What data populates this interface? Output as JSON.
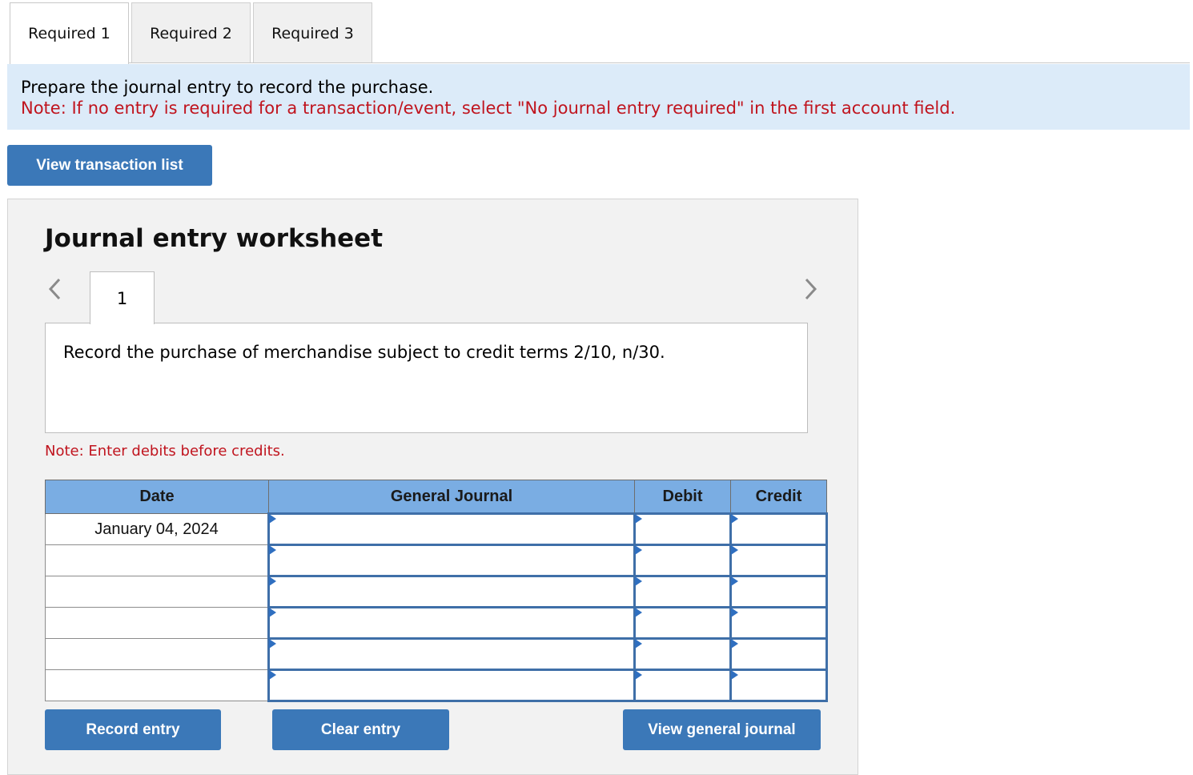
{
  "tabs": [
    {
      "label": "Required 1",
      "active": true
    },
    {
      "label": "Required 2",
      "active": false
    },
    {
      "label": "Required 3",
      "active": false
    }
  ],
  "instructions": {
    "main": "Prepare the journal entry to record the purchase.",
    "note": "Note: If no entry is required for a transaction/event, select \"No journal entry required\" in the first account field."
  },
  "buttons": {
    "view_transaction_list": "View transaction list",
    "record_entry": "Record entry",
    "clear_entry": "Clear entry",
    "view_general_journal": "View general journal"
  },
  "worksheet": {
    "title": "Journal entry worksheet",
    "current_page": "1",
    "description": "Record the purchase of merchandise subject to credit terms 2/10, n/30.",
    "note": "Note: Enter debits before credits.",
    "nav": {
      "prev_icon": "chevron-left-icon",
      "next_icon": "chevron-right-icon"
    }
  },
  "journal_table": {
    "headers": [
      "Date",
      "General Journal",
      "Debit",
      "Credit"
    ],
    "rows": [
      {
        "date": "January 04, 2024",
        "account": "",
        "debit": "",
        "credit": ""
      },
      {
        "date": "",
        "account": "",
        "debit": "",
        "credit": ""
      },
      {
        "date": "",
        "account": "",
        "debit": "",
        "credit": ""
      },
      {
        "date": "",
        "account": "",
        "debit": "",
        "credit": ""
      },
      {
        "date": "",
        "account": "",
        "debit": "",
        "credit": ""
      },
      {
        "date": "",
        "account": "",
        "debit": "",
        "credit": ""
      }
    ]
  },
  "colors": {
    "accent_button": "#3b78b8",
    "header_blue": "#7aade3",
    "note_red": "#c0141e",
    "instruction_bg": "#dcebf9"
  }
}
